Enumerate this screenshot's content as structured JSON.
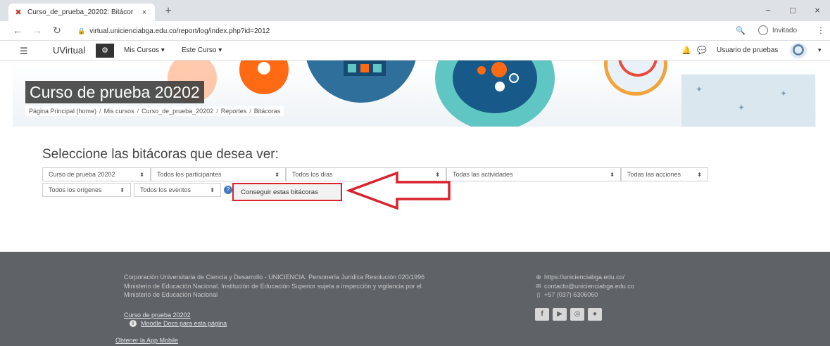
{
  "browser": {
    "tab_title": "Curso_de_prueba_20202: Bitácor",
    "tab_close": "×",
    "new_tab": "+",
    "url": "virtual.unicienciabga.edu.co/report/log/index.php?id=2012",
    "profile_label": "Invitado",
    "window_controls": [
      "−",
      "□",
      "×"
    ],
    "nav_icons": [
      "back-arrow-icon",
      "forward-arrow-icon",
      "reload-icon"
    ]
  },
  "navbar": {
    "brand": "UVirtual",
    "menu": [
      "Mis Cursos ▾",
      "Este Curso ▾"
    ],
    "user": "Usuario de pruebas"
  },
  "hero": {
    "course_title": "Curso de prueba 20202",
    "breadcrumb": [
      "Página Principal (home)",
      "Mis cursos",
      "Curso_de_prueba_20202",
      "Reportes",
      "Bitácoras"
    ],
    "breadcrumb_sep": "/"
  },
  "main": {
    "heading": "Seleccione las bitácoras que desea ver:",
    "selects_row1": [
      "Curso de prueba 20202",
      "Todos los participantes",
      "Todos los días",
      "Todas las actividades",
      "Todas las acciones"
    ],
    "selects_row2": [
      "Todos los orígenes",
      "Todos los eventos"
    ],
    "submit_label": "Conseguir estas bitácoras",
    "highlight_color": "#d9232f"
  },
  "footer": {
    "text_lines": [
      "Corporación Universitaria de Ciencia y Desarrollo - UNICIENCIA. Personería Jurídica Resolución 020/1996",
      "Ministerio de Educación Nacional. Institución de Educación Superior sujeta a inspección y vigilancia por el",
      "Ministerio de Educación Nacional"
    ],
    "contact": [
      "https://unicienciabga.edu.co/",
      "contacto@unicienciabga.edu.co",
      "+57 (037) 6306060"
    ],
    "course_link": "Curso de prueba 20202",
    "docs_link": "Moodle Docs para esta página",
    "app_link": "Obtener la App Mobile",
    "socials": [
      "f",
      "▶",
      "◎",
      "●"
    ]
  }
}
